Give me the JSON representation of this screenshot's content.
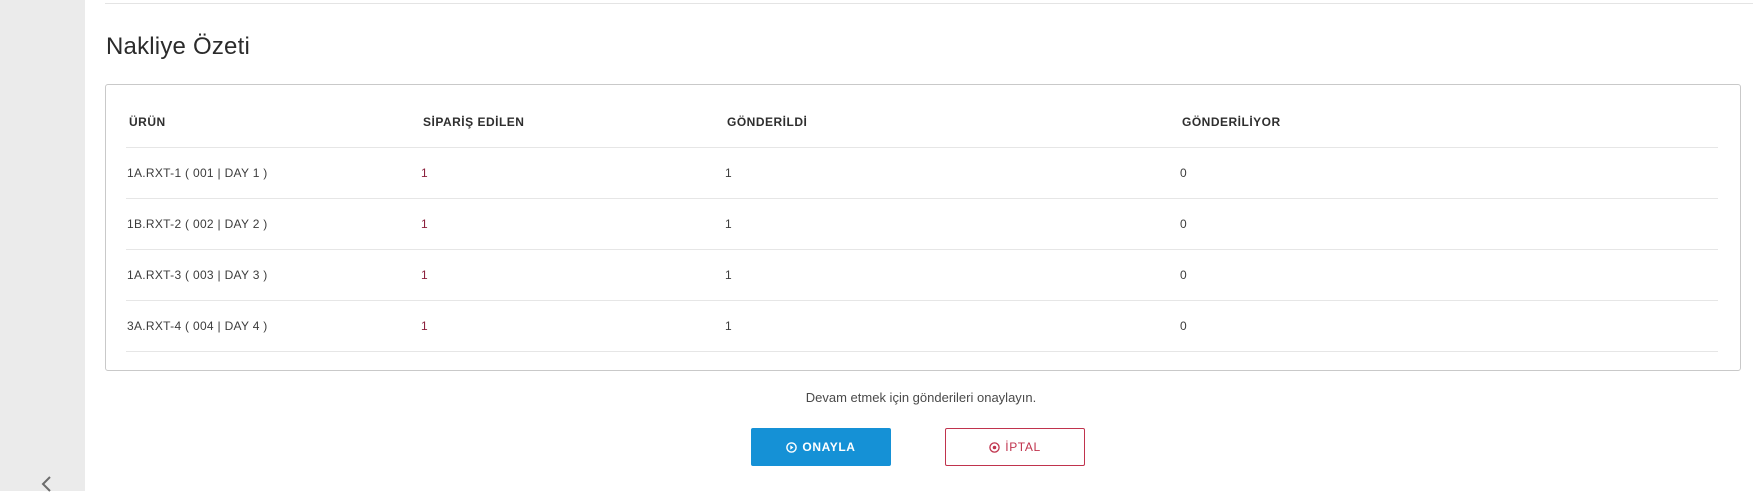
{
  "section": {
    "title": "Nakliye Özeti"
  },
  "table": {
    "headers": [
      "ÜRÜN",
      "SİPARİŞ EDİLEN",
      "GÖNDERİLDİ",
      "GÖNDERİLİYOR"
    ],
    "rows": [
      [
        "1A.RXT-1 ( 001 | DAY 1 )",
        "1",
        "1",
        "0"
      ],
      [
        "1B.RXT-2 ( 002 | DAY 2 )",
        "1",
        "1",
        "0"
      ],
      [
        "1A.RXT-3 ( 003 | DAY 3 )",
        "1",
        "1",
        "0"
      ],
      [
        "3A.RXT-4 ( 004 | DAY 4 )",
        "1",
        "1",
        "0"
      ]
    ]
  },
  "footer": {
    "hint": "Devam etmek için gönderileri onaylayın.",
    "confirm_label": "ONAYLA",
    "cancel_label": "İPTAL"
  },
  "icons": {
    "confirm": "circle-arrow-icon",
    "cancel": "circle-x-icon",
    "sidebar_toggle": "chevron-left-icon"
  },
  "colors": {
    "primary": "#1591d6",
    "danger": "#c0334d",
    "ordered_value": "#8a1f3b"
  }
}
